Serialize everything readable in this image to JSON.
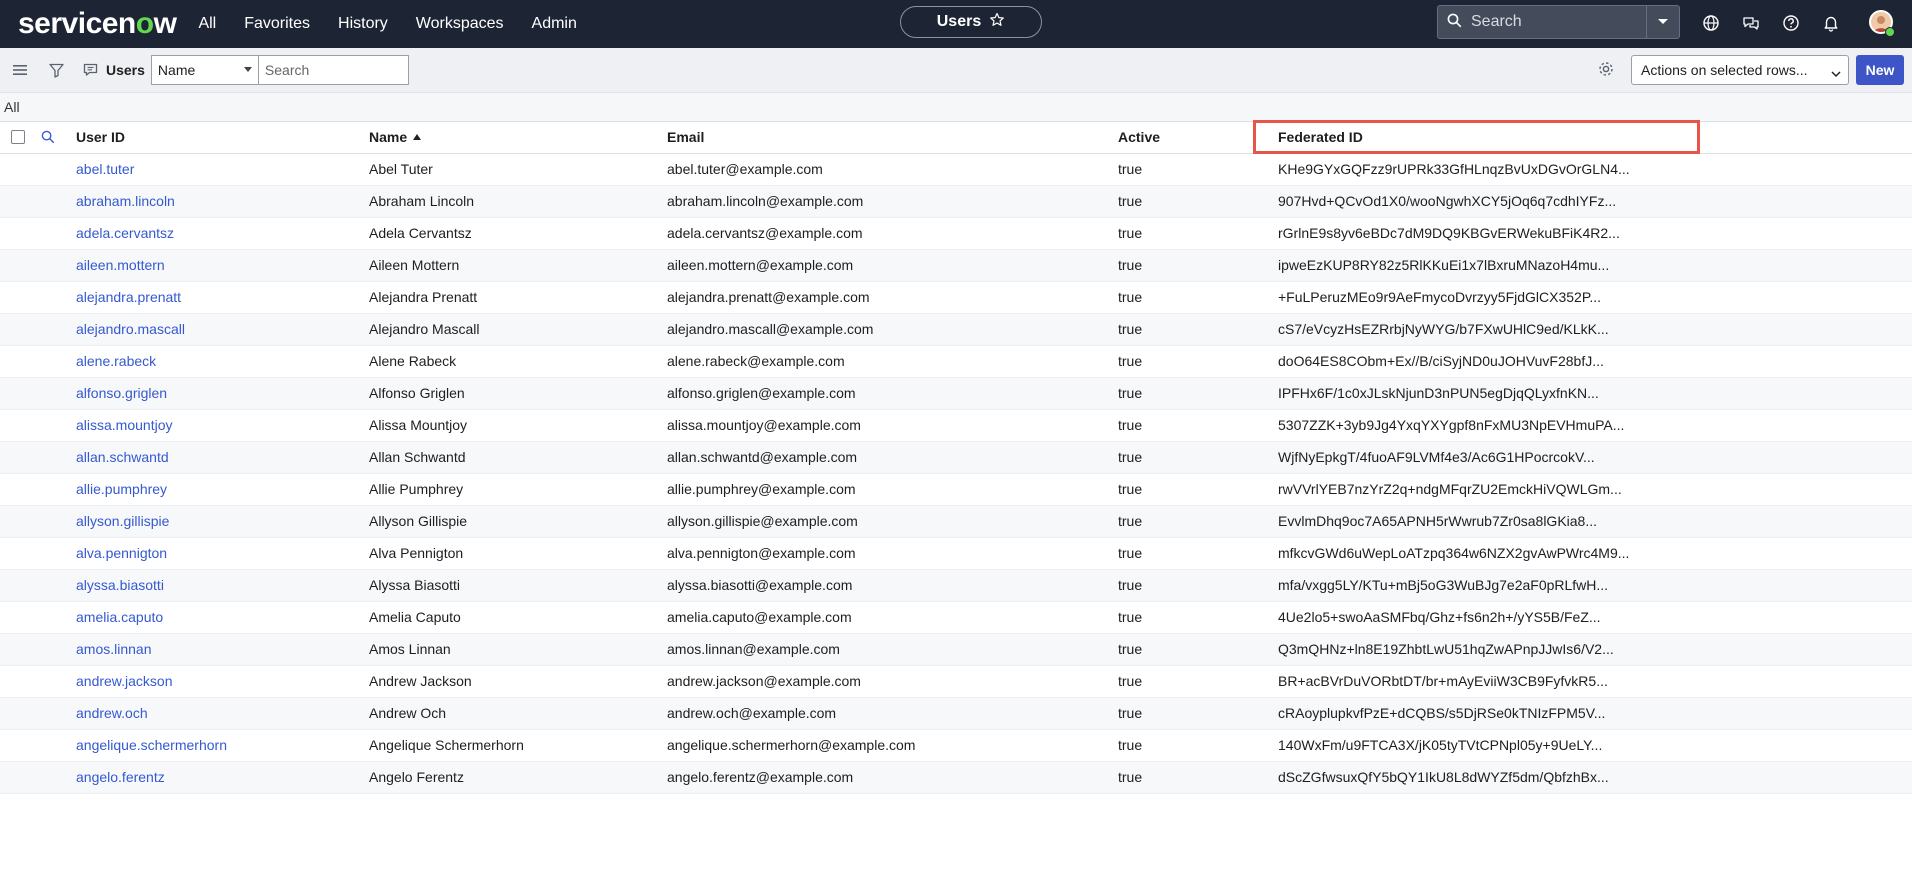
{
  "nav": {
    "logo_pre": "servicen",
    "logo_o": "o",
    "logo_post": "w",
    "menu": [
      "All",
      "Favorites",
      "History",
      "Workspaces",
      "Admin"
    ],
    "context_title": "Users",
    "search_placeholder": "Search"
  },
  "toolbar": {
    "title": "Users",
    "field_select": "Name",
    "search_placeholder": "Search",
    "actions_select": "Actions on selected rows...",
    "new_label": "New"
  },
  "breadcrumb": "All",
  "table": {
    "headers": [
      "User ID",
      "Name",
      "Email",
      "Active",
      "Federated ID"
    ],
    "sort_column": "Name",
    "rows": [
      [
        "abel.tuter",
        "Abel Tuter",
        "abel.tuter@example.com",
        "true",
        "KHe9GYxGQFzz9rUPRk33GfHLnqzBvUxDGvOrGLN4..."
      ],
      [
        "abraham.lincoln",
        "Abraham Lincoln",
        "abraham.lincoln@example.com",
        "true",
        "907Hvd+QCvOd1X0/wooNgwhXCY5jOq6q7cdhIYFz..."
      ],
      [
        "adela.cervantsz",
        "Adela Cervantsz",
        "adela.cervantsz@example.com",
        "true",
        "rGrlnE9s8yv6eBDc7dM9DQ9KBGvERWekuBFiK4R2..."
      ],
      [
        "aileen.mottern",
        "Aileen Mottern",
        "aileen.mottern@example.com",
        "true",
        "ipweEzKUP8RY82z5RlKKuEi1x7lBxruMNazoH4mu..."
      ],
      [
        "alejandra.prenatt",
        "Alejandra Prenatt",
        "alejandra.prenatt@example.com",
        "true",
        "+FuLPeruzMEo9r9AeFmycoDvrzyy5FjdGlCX352P..."
      ],
      [
        "alejandro.mascall",
        "Alejandro Mascall",
        "alejandro.mascall@example.com",
        "true",
        "cS7/eVcyzHsEZRrbjNyWYG/b7FXwUHlC9ed/KLkK..."
      ],
      [
        "alene.rabeck",
        "Alene Rabeck",
        "alene.rabeck@example.com",
        "true",
        "doO64ES8CObm+Ex//B/ciSyjND0uJOHVuvF28bfJ..."
      ],
      [
        "alfonso.griglen",
        "Alfonso Griglen",
        "alfonso.griglen@example.com",
        "true",
        "IPFHx6F/1c0xJLskNjunD3nPUN5egDjqQLyxfnKN..."
      ],
      [
        "alissa.mountjoy",
        "Alissa Mountjoy",
        "alissa.mountjoy@example.com",
        "true",
        "5307ZZK+3yb9Jg4YxqYXYgpf8nFxMU3NpEVHmuPA..."
      ],
      [
        "allan.schwantd",
        "Allan Schwantd",
        "allan.schwantd@example.com",
        "true",
        "WjfNyEpkgT/4fuoAF9LVMf4e3/Ac6G1HPocrcokV..."
      ],
      [
        "allie.pumphrey",
        "Allie Pumphrey",
        "allie.pumphrey@example.com",
        "true",
        "rwVVrlYEB7nzYrZ2q+ndgMFqrZU2EmckHiVQWLGm..."
      ],
      [
        "allyson.gillispie",
        "Allyson Gillispie",
        "allyson.gillispie@example.com",
        "true",
        "EvvlmDhq9oc7A65APNH5rWwrub7Zr0sa8lGKia8..."
      ],
      [
        "alva.pennigton",
        "Alva Pennigton",
        "alva.pennigton@example.com",
        "true",
        "mfkcvGWd6uWepLoATzpq364w6NZX2gvAwPWrc4M9..."
      ],
      [
        "alyssa.biasotti",
        "Alyssa Biasotti",
        "alyssa.biasotti@example.com",
        "true",
        "mfa/vxgg5LY/KTu+mBj5oG3WuBJg7e2aF0pRLfwH..."
      ],
      [
        "amelia.caputo",
        "Amelia Caputo",
        "amelia.caputo@example.com",
        "true",
        "4Ue2lo5+swoAaSMFbq/Ghz+fs6n2h+/yYS5B/FeZ..."
      ],
      [
        "amos.linnan",
        "Amos Linnan",
        "amos.linnan@example.com",
        "true",
        "Q3mQHNz+ln8E19ZhbtLwU51hqZwAPnpJJwIs6/V2..."
      ],
      [
        "andrew.jackson",
        "Andrew Jackson",
        "andrew.jackson@example.com",
        "true",
        "BR+acBVrDuVORbtDT/br+mAyEviiW3CB9FyfvkR5..."
      ],
      [
        "andrew.och",
        "Andrew Och",
        "andrew.och@example.com",
        "true",
        "cRAoyplupkvfPzE+dCQBS/s5DjRSe0kTNIzFPM5V..."
      ],
      [
        "angelique.schermerhorn",
        "Angelique Schermerhorn",
        "angelique.schermerhorn@example.com",
        "true",
        "140WxFm/u9FTCA3X/jK05tyTVtCPNpl05y+9UeLY..."
      ],
      [
        "angelo.ferentz",
        "Angelo Ferentz",
        "angelo.ferentz@example.com",
        "true",
        "dScZGfwsuxQfY5bQY1IkU8L8dWYZf5dm/QbfzhBx..."
      ]
    ]
  },
  "colors": {
    "nav_bg": "#1d2433",
    "accent": "#3d55c7",
    "link": "#3459d1",
    "highlight": "#e5554a",
    "logo_o": "#62d84e"
  },
  "icons": [
    "search-icon",
    "chevron-down-icon",
    "globe-icon",
    "chat-icon",
    "help-icon",
    "bell-icon",
    "avatar",
    "star-icon",
    "menu-icon",
    "filter-icon",
    "comment-icon",
    "gear-icon"
  ]
}
